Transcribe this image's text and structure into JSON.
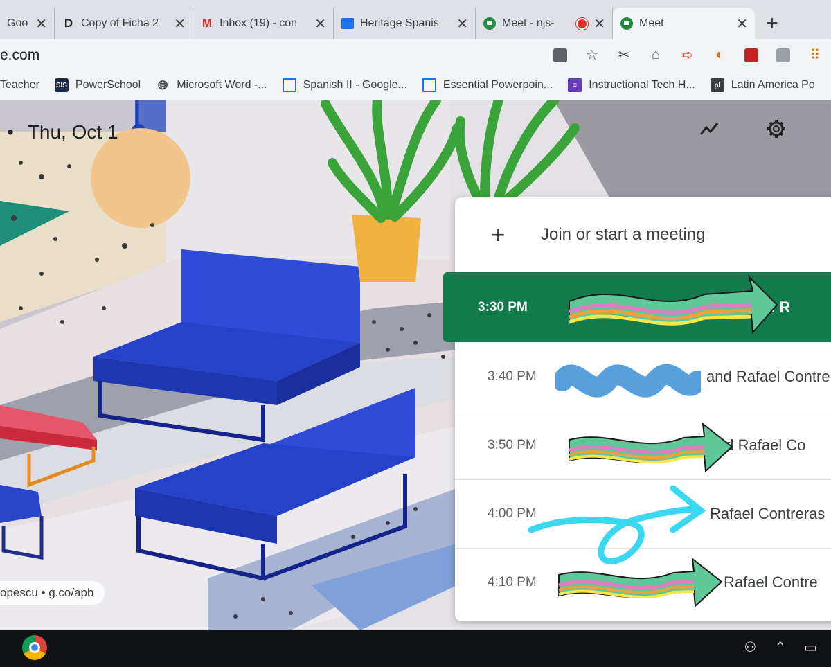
{
  "browser": {
    "tabs": [
      {
        "label": "Goo",
        "icon": "google-docs-icon"
      },
      {
        "label": "Copy of Ficha 2",
        "icon": "docs-d-icon"
      },
      {
        "label": "Inbox (19) - con",
        "icon": "gmail-icon"
      },
      {
        "label": "Heritage Spanis",
        "icon": "classroom-icon"
      },
      {
        "label": "Meet - njs-",
        "icon": "meet-icon"
      },
      {
        "label": "Meet",
        "icon": "meet-icon"
      }
    ],
    "new_tab": "+",
    "close_glyph": "✕",
    "address": "e.com",
    "bookmarks": [
      {
        "label": "Teacher"
      },
      {
        "label": "PowerSchool",
        "icon_text": "SIS"
      },
      {
        "label": "Microsoft Word -..."
      },
      {
        "label": "Spanish II - Google..."
      },
      {
        "label": "Essential Powerpoin..."
      },
      {
        "label": "Instructional Tech H..."
      },
      {
        "label": "Latin America Po"
      }
    ]
  },
  "stage": {
    "date_bullet": "•",
    "date": "Thu, Oct 1",
    "credit": "opescu  •  g.co/apb"
  },
  "meet": {
    "join_label": "Join or start a meeting",
    "join_icon": "+",
    "meetings": [
      {
        "time": "3:30 PM",
        "title": "and R",
        "active": true
      },
      {
        "time": "3:40 PM",
        "title": "and Rafael Contre"
      },
      {
        "time": "3:50 PM",
        "title": "nd Rafael Co"
      },
      {
        "time": "4:00 PM",
        "title": "Rafael Contreras"
      },
      {
        "time": "4:10 PM",
        "title": "Rafael Contre"
      }
    ]
  },
  "colors": {
    "active_row": "#137a4d",
    "tab_strip": "#dee1e6",
    "toolbar": "#f1f3f4"
  }
}
